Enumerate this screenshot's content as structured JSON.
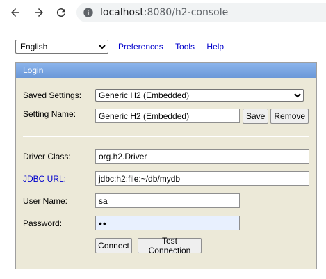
{
  "browser": {
    "url_host": "localhost",
    "url_rest": ":8080/h2-console"
  },
  "topbar": {
    "language": "English",
    "links": [
      "Preferences",
      "Tools",
      "Help"
    ]
  },
  "login": {
    "title": "Login",
    "saved_settings_label": "Saved Settings:",
    "saved_settings_value": "Generic H2 (Embedded)",
    "setting_name_label": "Setting Name:",
    "setting_name_value": "Generic H2 (Embedded)",
    "save_label": "Save",
    "remove_label": "Remove",
    "driver_class_label": "Driver Class:",
    "driver_class_value": "org.h2.Driver",
    "jdbc_url_label": "JDBC URL:",
    "jdbc_url_value": "jdbc:h2:file:~/db/mydb",
    "user_name_label": "User Name:",
    "user_name_value": "sa",
    "password_label": "Password:",
    "password_mask": "••",
    "connect_label": "Connect",
    "test_connection_label": "Test Connection"
  }
}
